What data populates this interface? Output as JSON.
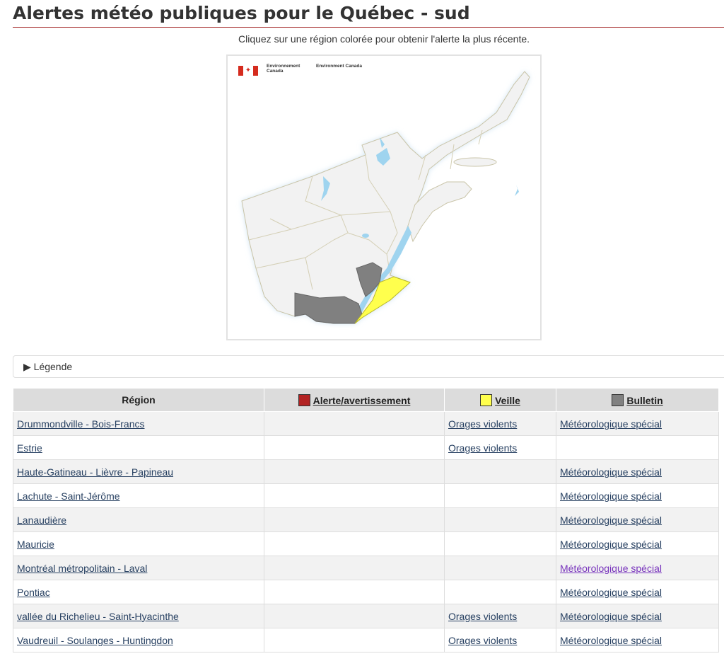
{
  "page": {
    "title": "Alertes météo publiques pour le Québec - sud",
    "instruction": "Cliquez sur une région colorée pour obtenir l'alerte la plus récente."
  },
  "logo": {
    "fr": "Environnement Canada",
    "en": "Environment Canada"
  },
  "legend": {
    "label": "▶ Légende"
  },
  "table": {
    "headers": {
      "region": "Région",
      "warning": "Alerte/avertissement",
      "watch": "Veille",
      "statement": "Bulletin"
    },
    "colors": {
      "warning": "#b22222",
      "watch": "#ffff4d",
      "statement": "#808080"
    },
    "rows": [
      {
        "region": "Drummondville - Bois-Francs",
        "warning": "",
        "watch": "Orages violents",
        "statement": "Météorologique spécial"
      },
      {
        "region": "Estrie",
        "warning": "",
        "watch": "Orages violents",
        "statement": ""
      },
      {
        "region": "Haute-Gatineau - Lièvre - Papineau",
        "warning": "",
        "watch": "",
        "statement": "Météorologique spécial"
      },
      {
        "region": "Lachute - Saint-Jérôme",
        "warning": "",
        "watch": "",
        "statement": "Météorologique spécial"
      },
      {
        "region": "Lanaudière",
        "warning": "",
        "watch": "",
        "statement": "Météorologique spécial"
      },
      {
        "region": "Mauricie",
        "warning": "",
        "watch": "",
        "statement": "Météorologique spécial"
      },
      {
        "region": "Montréal métropolitain - Laval",
        "warning": "",
        "watch": "",
        "statement": "Météorologique spécial"
      },
      {
        "region": "Pontiac",
        "warning": "",
        "watch": "",
        "statement": "Météorologique spécial"
      },
      {
        "region": "vallée du Richelieu - Saint-Hyacinthe",
        "warning": "",
        "watch": "Orages violents",
        "statement": "Météorologique spécial"
      },
      {
        "region": "Vaudreuil - Soulanges - Huntingdon",
        "warning": "",
        "watch": "Orages violents",
        "statement": "Météorologique spécial"
      }
    ]
  }
}
